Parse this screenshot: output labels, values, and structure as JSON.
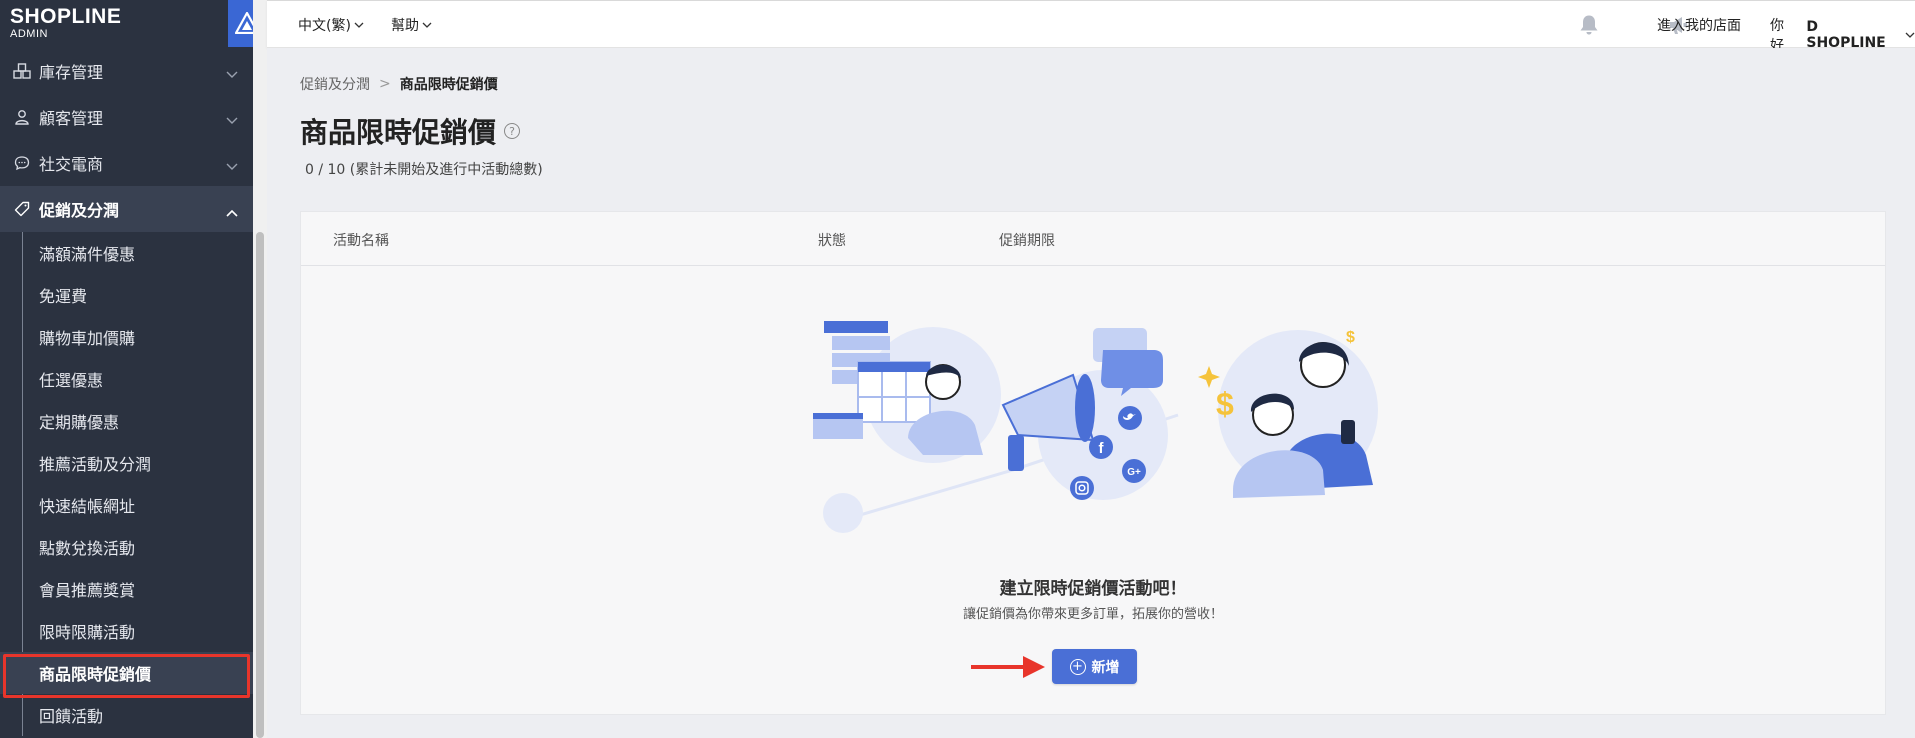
{
  "brand": {
    "name": "SHOPLINE",
    "sub": "ADMIN"
  },
  "sidebar": {
    "items": [
      {
        "label": "庫存管理",
        "icon": "inventory-icon"
      },
      {
        "label": "顧客管理",
        "icon": "user-icon"
      },
      {
        "label": "社交電商",
        "icon": "chat-icon"
      },
      {
        "label": "促銷及分潤",
        "icon": "tag-icon"
      }
    ],
    "sub_items": [
      "滿額滿件優惠",
      "免運費",
      "購物車加價購",
      "任選優惠",
      "定期購優惠",
      "推薦活動及分潤",
      "快速結帳網址",
      "點數兌換活動",
      "會員推薦獎賞",
      "限時限購活動",
      "商品限時促銷價",
      "回饋活動"
    ]
  },
  "topbar": {
    "language": "中文(繁)",
    "help": "幫助",
    "store_link": "進入我的店面",
    "greeting": "你好,",
    "user": "D SHOPLINE"
  },
  "breadcrumb": {
    "parent": "促銷及分潤",
    "separator": ">",
    "current": "商品限時促銷價"
  },
  "page": {
    "title": "商品限時促銷價",
    "count": "0 / 10 (累計未開始及進行中活動總數)"
  },
  "table": {
    "columns": [
      "活動名稱",
      "狀態",
      "促銷期限"
    ]
  },
  "empty_state": {
    "title": "建立限時促銷價活動吧！",
    "subtitle": "讓促銷價為你帶來更多訂單，拓展你的營收！",
    "button": "新增"
  },
  "colors": {
    "sidebar_bg": "#2b3240",
    "accent": "#4a6fd6",
    "highlight": "#e8352b",
    "content_bg": "#edeef2"
  }
}
